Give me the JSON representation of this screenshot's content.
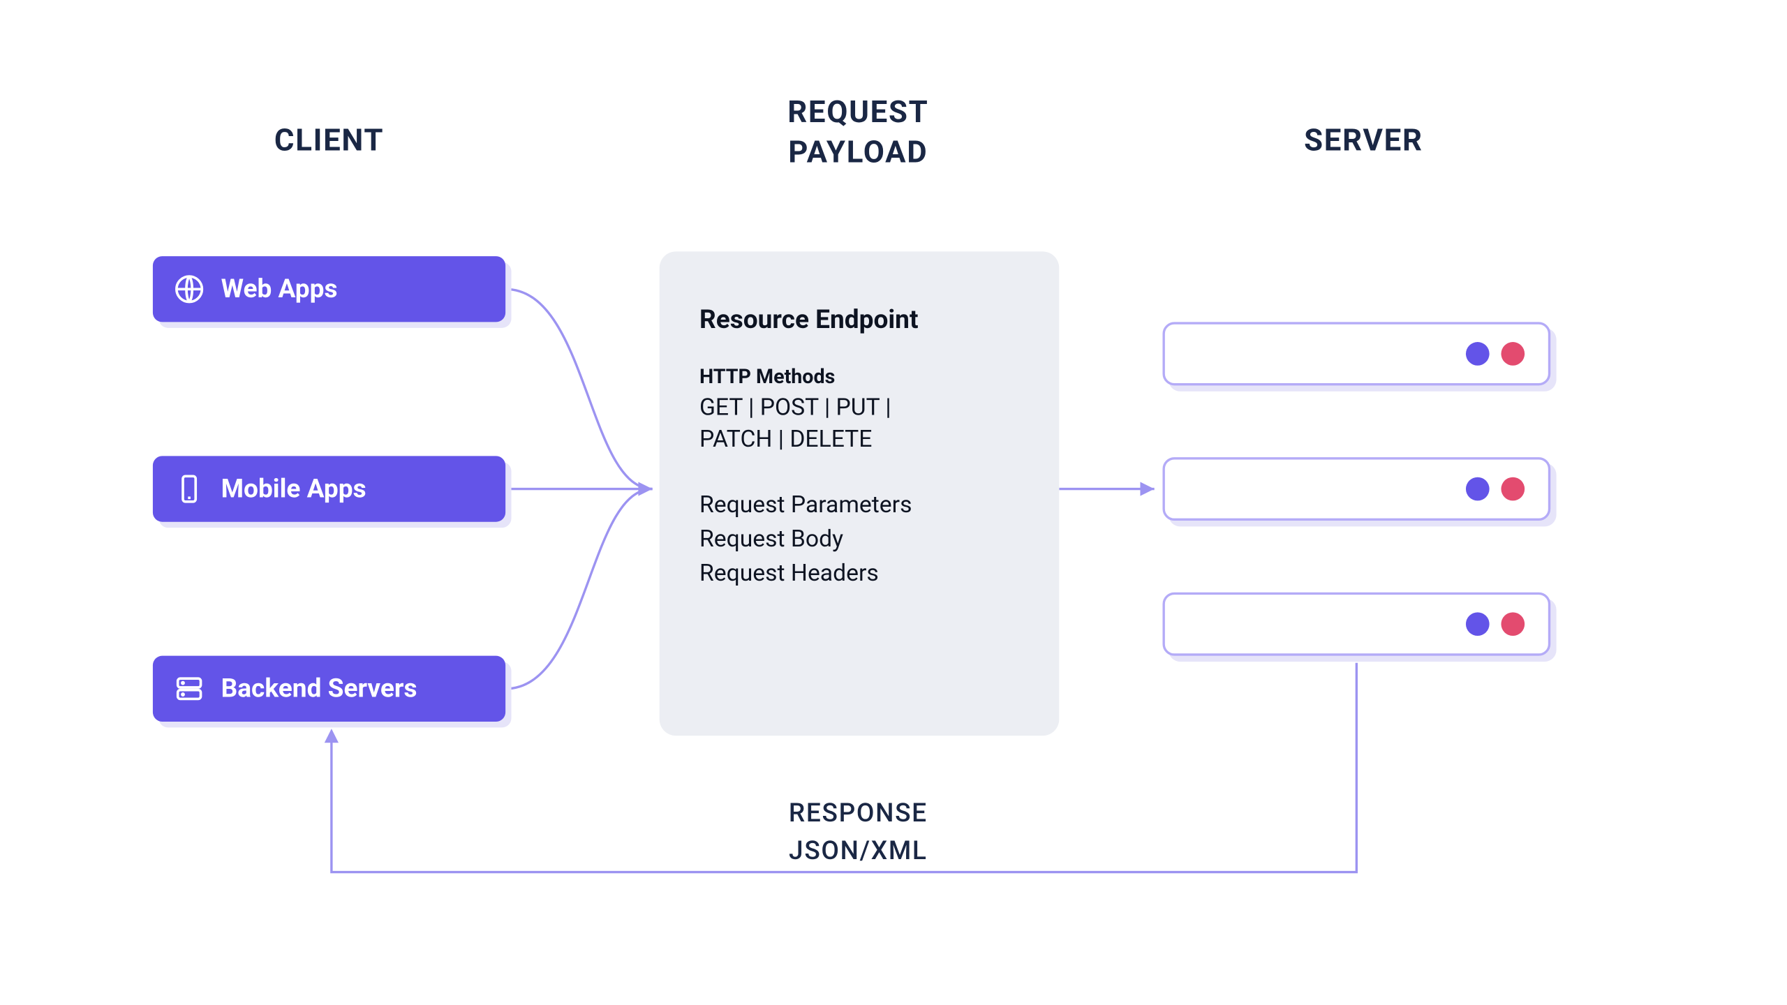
{
  "headings": {
    "client": "CLIENT",
    "request_line1": "REQUEST",
    "request_line2": "PAYLOAD",
    "server": "SERVER"
  },
  "clients": {
    "web": "Web Apps",
    "mobile": "Mobile Apps",
    "backend": "Backend Servers"
  },
  "payload": {
    "title": "Resource Endpoint",
    "methods_label": "HTTP Methods",
    "methods_line1": "GET | POST | PUT |",
    "methods_line2": "PATCH | DELETE",
    "req_params": "Request Parameters",
    "req_body": "Request Body",
    "req_headers": "Request Headers"
  },
  "response": {
    "line1": "RESPONSE",
    "line2": "JSON/XML"
  },
  "colors": {
    "accent": "#6354e8",
    "wire": "#9c93f1",
    "shadow": "#e6e4f9",
    "dot_red": "#e34b6f",
    "heading": "#1a2744",
    "card_bg": "#eceef3"
  }
}
